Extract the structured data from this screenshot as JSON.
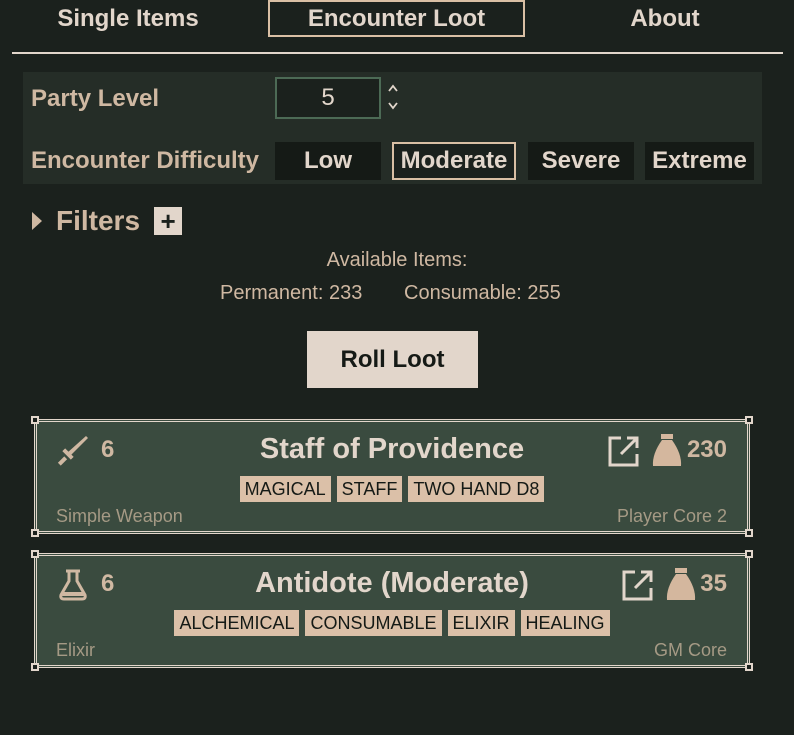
{
  "nav": {
    "tabs": [
      {
        "label": "Single Items"
      },
      {
        "label": "Encounter Loot"
      },
      {
        "label": "About"
      }
    ]
  },
  "party": {
    "level_label": "Party Level",
    "level_value": "5",
    "difficulty_label": "Encounter Difficulty",
    "difficulties": [
      "Low",
      "Moderate",
      "Severe",
      "Extreme"
    ],
    "selected_difficulty": "Moderate"
  },
  "filters": {
    "label": "Filters",
    "add_symbol": "+"
  },
  "available": {
    "label": "Available Items:",
    "permanent": "Permanent: 233",
    "consumable": "Consumable: 255"
  },
  "roll_label": "Roll Loot",
  "loot": [
    {
      "icon": "sword-icon",
      "level": "6",
      "name": "Staff of Providence",
      "price": "230",
      "tags": [
        "MAGICAL",
        "STAFF",
        "TWO HAND D8"
      ],
      "category": "Simple Weapon",
      "source": "Player Core 2"
    },
    {
      "icon": "flask-icon",
      "level": "6",
      "name": "Antidote (Moderate)",
      "price": "35",
      "tags": [
        "ALCHEMICAL",
        "CONSUMABLE",
        "ELIXIR",
        "HEALING"
      ],
      "category": "Elixir",
      "source": "GM Core"
    }
  ],
  "colors": {
    "background": "#1b211d",
    "panel": "#252d27",
    "card": "#3a4b3f",
    "accent": "#d9bfa4",
    "text": "#e2d6cb",
    "tag": "#dbc0a8"
  }
}
